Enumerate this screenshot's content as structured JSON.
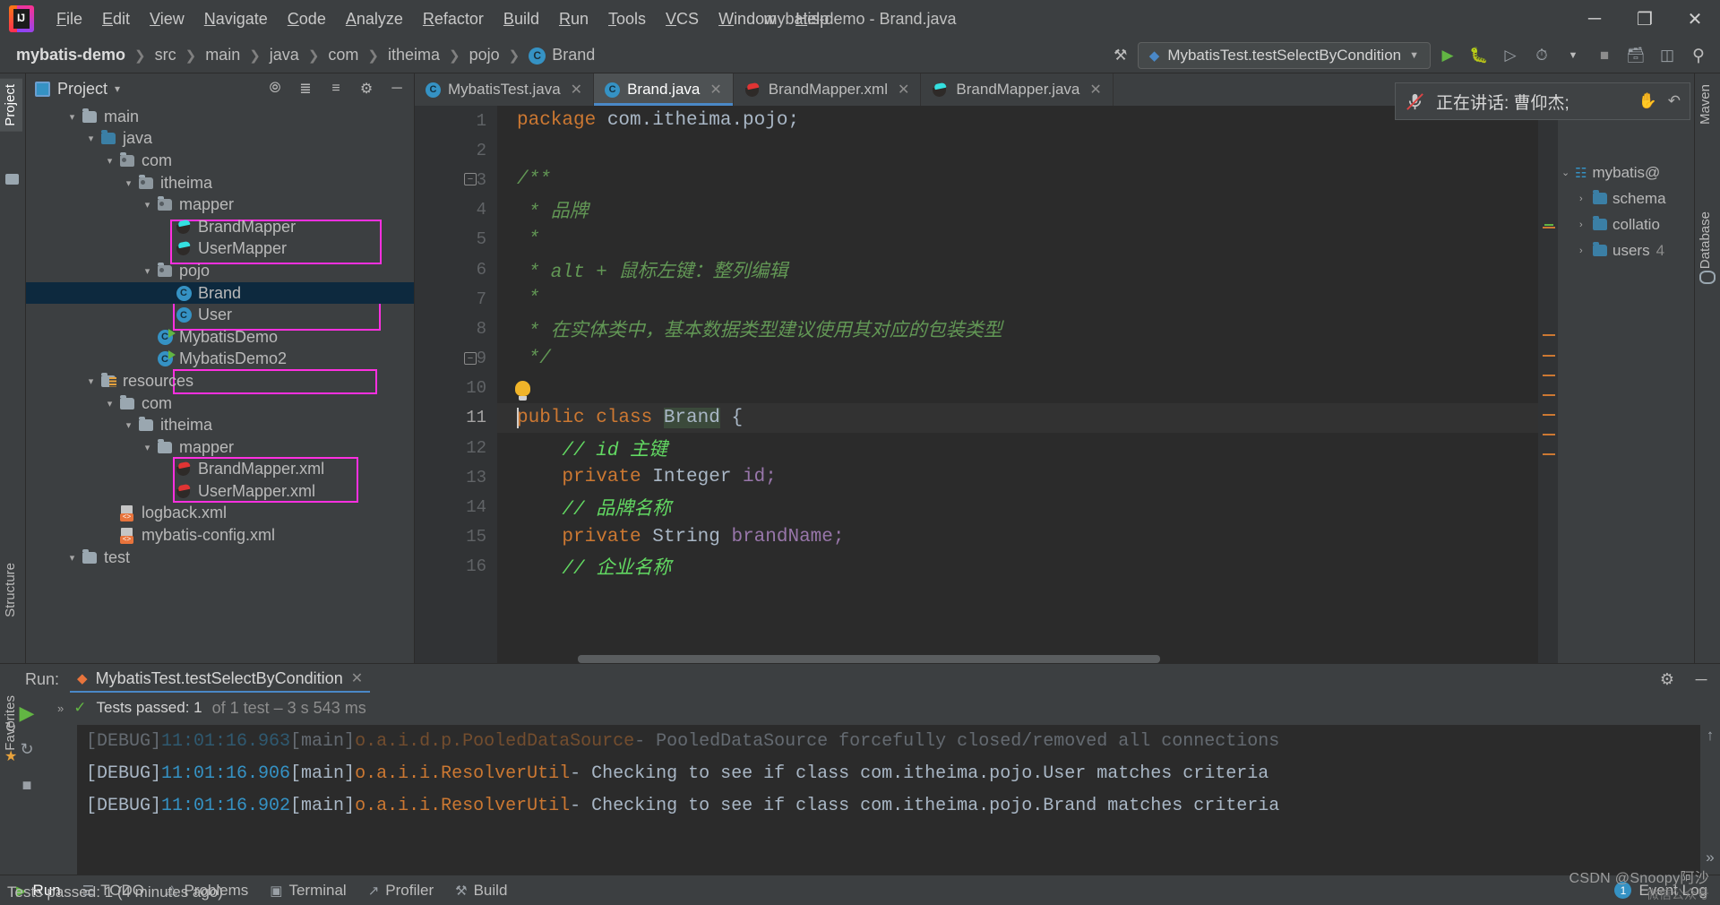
{
  "window": {
    "title": "mybatis-demo - Brand.java",
    "minimize": "─",
    "maximize": "❐",
    "close": "✕"
  },
  "menu": {
    "items": [
      "File",
      "Edit",
      "View",
      "Navigate",
      "Code",
      "Analyze",
      "Refactor",
      "Build",
      "Run",
      "Tools",
      "VCS",
      "Window",
      "Help"
    ]
  },
  "breadcrumb": {
    "items": [
      "mybatis-demo",
      "src",
      "main",
      "java",
      "com",
      "itheima",
      "pojo"
    ],
    "last": "Brand",
    "last_badge": "C"
  },
  "toolbar": {
    "run_config": "MybatisTest.testSelectByCondition",
    "run_icon": "▶",
    "debug_icon": "⚙",
    "coverage_icon": "▶",
    "profile_icon": "◴",
    "stop_icon": "■",
    "search_icon": "⚲",
    "build_icon": "⚒"
  },
  "project_panel": {
    "title": "Project",
    "caret": "▾",
    "icons": [
      "locate-icon",
      "expand-icon",
      "collapse-icon",
      "settings-icon",
      "hide-icon"
    ],
    "tree": [
      {
        "label": "main",
        "indent": 1,
        "arrow": "⌄",
        "icon": "folder"
      },
      {
        "label": "java",
        "indent": 2,
        "arrow": "⌄",
        "icon": "folder-blue"
      },
      {
        "label": "com",
        "indent": 3,
        "arrow": "⌄",
        "icon": "package"
      },
      {
        "label": "itheima",
        "indent": 4,
        "arrow": "⌄",
        "icon": "package"
      },
      {
        "label": "mapper",
        "indent": 5,
        "arrow": "⌄",
        "icon": "package"
      },
      {
        "label": "BrandMapper",
        "indent": 6,
        "arrow": "",
        "icon": "mybatis"
      },
      {
        "label": "UserMapper",
        "indent": 6,
        "arrow": "",
        "icon": "mybatis"
      },
      {
        "label": "pojo",
        "indent": 5,
        "arrow": "⌄",
        "icon": "package"
      },
      {
        "label": "Brand",
        "indent": 6,
        "arrow": "",
        "icon": "java-class",
        "selected": true
      },
      {
        "label": "User",
        "indent": 6,
        "arrow": "",
        "icon": "java-class"
      },
      {
        "label": "MybatisDemo",
        "indent": 5,
        "arrow": "",
        "icon": "java-runnable"
      },
      {
        "label": "MybatisDemo2",
        "indent": 5,
        "arrow": "",
        "icon": "java-runnable"
      },
      {
        "label": "resources",
        "indent": 2,
        "arrow": "⌄",
        "icon": "folder-resources"
      },
      {
        "label": "com",
        "indent": 3,
        "arrow": "⌄",
        "icon": "folder"
      },
      {
        "label": "itheima",
        "indent": 4,
        "arrow": "⌄",
        "icon": "folder"
      },
      {
        "label": "mapper",
        "indent": 5,
        "arrow": "⌄",
        "icon": "folder"
      },
      {
        "label": "BrandMapper.xml",
        "indent": 6,
        "arrow": "",
        "icon": "mybatis-red"
      },
      {
        "label": "UserMapper.xml",
        "indent": 6,
        "arrow": "",
        "icon": "mybatis-red"
      },
      {
        "label": "logback.xml",
        "indent": 3,
        "arrow": "",
        "icon": "xml"
      },
      {
        "label": "mybatis-config.xml",
        "indent": 3,
        "arrow": "",
        "icon": "xml"
      },
      {
        "label": "test",
        "indent": 1,
        "arrow": "⌄",
        "icon": "folder"
      }
    ],
    "highlight_color": "#ff30e0"
  },
  "editor": {
    "tabs": [
      {
        "label": "MybatisTest.java",
        "icon": "java-class",
        "active": false
      },
      {
        "label": "Brand.java",
        "icon": "java-class",
        "active": true
      },
      {
        "label": "BrandMapper.xml",
        "icon": "mybatis-red",
        "active": false
      },
      {
        "label": "BrandMapper.java",
        "icon": "mybatis",
        "active": false
      }
    ],
    "lines": [
      {
        "n": "1",
        "segments": [
          {
            "t": "package ",
            "c": "kw"
          },
          {
            "t": "com.itheima.pojo;",
            "c": "typ"
          }
        ]
      },
      {
        "n": "2",
        "segments": []
      },
      {
        "n": "3",
        "segments": [
          {
            "t": "/**",
            "c": "cmt"
          }
        ],
        "fold": "−"
      },
      {
        "n": "4",
        "segments": [
          {
            "t": " * 品牌",
            "c": "cmt"
          }
        ]
      },
      {
        "n": "5",
        "segments": [
          {
            "t": " *",
            "c": "cmt"
          }
        ]
      },
      {
        "n": "6",
        "segments": [
          {
            "t": " * alt + 鼠标左键：整列编辑",
            "c": "cmt"
          }
        ]
      },
      {
        "n": "7",
        "segments": [
          {
            "t": " *",
            "c": "cmt"
          }
        ]
      },
      {
        "n": "8",
        "segments": [
          {
            "t": " * 在实体类中，基本数据类型建议使用其对应的包装类型",
            "c": "cmt"
          }
        ]
      },
      {
        "n": "9",
        "segments": [
          {
            "t": " */",
            "c": "cmt"
          }
        ],
        "fold": "−"
      },
      {
        "n": "10",
        "segments": [],
        "bulb": true
      },
      {
        "n": "11",
        "segments": [
          {
            "t": "public class ",
            "c": "kw"
          },
          {
            "t": "Brand",
            "c": "sel-tok"
          },
          {
            "t": " {",
            "c": "typ"
          }
        ],
        "current": true,
        "caret": true
      },
      {
        "n": "12",
        "segments": [
          {
            "t": "    // id 主键",
            "c": "cmt2"
          }
        ]
      },
      {
        "n": "13",
        "segments": [
          {
            "t": "    private ",
            "c": "kw"
          },
          {
            "t": "Integer",
            "c": "typ"
          },
          {
            "t": " id;",
            "c": "fld"
          }
        ]
      },
      {
        "n": "14",
        "segments": [
          {
            "t": "    // 品牌名称",
            "c": "cmt2"
          }
        ]
      },
      {
        "n": "15",
        "segments": [
          {
            "t": "    private ",
            "c": "kw"
          },
          {
            "t": "String",
            "c": "typ"
          },
          {
            "t": " brandName;",
            "c": "fld"
          }
        ]
      },
      {
        "n": "16",
        "segments": [
          {
            "t": "    // 企业名称",
            "c": "cmt2"
          }
        ]
      }
    ]
  },
  "toast": {
    "icon": "mic-muted-icon",
    "text": "正在讲话: 曹仰杰;"
  },
  "database_panel": {
    "title": "Database",
    "rows": [
      {
        "label": "mybatis@",
        "indent": 0,
        "arrow": "⌄",
        "icon": "db"
      },
      {
        "label": "schema",
        "indent": 1,
        "arrow": "›",
        "icon": "folder"
      },
      {
        "label": "collatio",
        "indent": 1,
        "arrow": "›",
        "icon": "folder"
      },
      {
        "label": "users",
        "indent": 1,
        "arrow": "›",
        "icon": "folder",
        "suffix": "4"
      }
    ]
  },
  "run_panel": {
    "label": "Run:",
    "tab": "MybatisTest.testSelectByCondition",
    "close": "✕",
    "settings_icon": "⚙",
    "hide_icon": "─",
    "test_summary_ok": "Tests passed: 1",
    "test_summary_rest": "of 1 test – 3 s 543 ms",
    "console_lines": [
      {
        "level": "[DEBUG]",
        "time": "11:01:16.902",
        "thread": "[main]",
        "logger": "o.a.i.i.ResolverUtil",
        "msg": "- Checking to see if class com.itheima.pojo.Brand matches criteriа"
      },
      {
        "level": "[DEBUG]",
        "time": "11:01:16.906",
        "thread": "[main]",
        "logger": "o.a.i.i.ResolverUtil",
        "msg": "- Checking to see if class com.itheima.pojo.User matches criteria"
      },
      {
        "level": "[DEBUG]",
        "time": "11:01:16.963",
        "thread": "[main]",
        "logger": "o.a.i.d.p.PooledDataSource",
        "msg": "- PooledDataSource forcefully closed/removed all connections"
      }
    ],
    "scroll_up": "↑",
    "scroll_down": "»"
  },
  "status_bar": {
    "items": [
      {
        "label": "Run",
        "icon": "▶"
      },
      {
        "label": "TODO",
        "icon": "☰"
      },
      {
        "label": "Problems",
        "icon": "⚠"
      },
      {
        "label": "Terminal",
        "icon": "▣"
      },
      {
        "label": "Profiler",
        "icon": "↗"
      },
      {
        "label": "Build",
        "icon": "⚒"
      }
    ],
    "event_log": "Event Log",
    "event_count": "1",
    "message": "Tests passed: 1 (4 minutes ago)",
    "watermark": "CSDN @Snoopy阿沙",
    "watermark2": "微信公众号"
  },
  "side_tabs": {
    "left": [
      "Project",
      "Structure",
      "Favorites"
    ],
    "right": [
      "Database",
      "Maven"
    ]
  }
}
